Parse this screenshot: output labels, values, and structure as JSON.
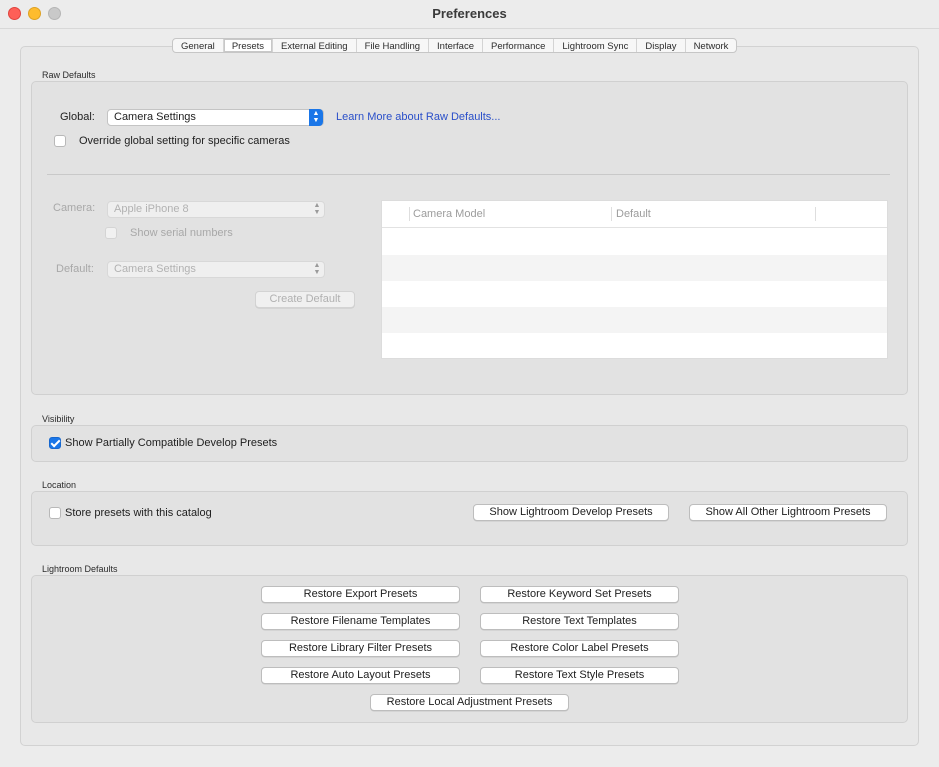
{
  "window": {
    "title": "Preferences"
  },
  "tabs": [
    {
      "label": "General",
      "active": false
    },
    {
      "label": "Presets",
      "active": true
    },
    {
      "label": "External Editing",
      "active": false
    },
    {
      "label": "File Handling",
      "active": false
    },
    {
      "label": "Interface",
      "active": false
    },
    {
      "label": "Performance",
      "active": false
    },
    {
      "label": "Lightroom Sync",
      "active": false
    },
    {
      "label": "Display",
      "active": false
    },
    {
      "label": "Network",
      "active": false
    }
  ],
  "raw_defaults": {
    "section_label": "Raw Defaults",
    "global_label": "Global:",
    "global_value": "Camera Settings",
    "learn_more": "Learn More about Raw Defaults...",
    "override_label": "Override global setting for specific cameras",
    "override_checked": false,
    "camera_label": "Camera:",
    "camera_value": "Apple iPhone 8",
    "serial_label": "Show serial numbers",
    "default_label": "Default:",
    "default_value": "Camera Settings",
    "create_default": "Create Default",
    "table": {
      "columns": [
        "Camera Model",
        "Default"
      ],
      "rows": []
    }
  },
  "visibility": {
    "section_label": "Visibility",
    "show_partial_label": "Show Partially Compatible Develop Presets",
    "show_partial_checked": true
  },
  "location": {
    "section_label": "Location",
    "store_label": "Store presets with this catalog",
    "store_checked": false,
    "show_develop": "Show Lightroom Develop Presets",
    "show_other": "Show All Other Lightroom Presets"
  },
  "lightroom_defaults": {
    "section_label": "Lightroom Defaults",
    "buttons": {
      "export": "Restore Export Presets",
      "keyword_set": "Restore Keyword Set Presets",
      "filename": "Restore Filename Templates",
      "text_templates": "Restore Text Templates",
      "library_filter": "Restore Library Filter Presets",
      "color_label": "Restore Color Label Presets",
      "auto_layout": "Restore Auto Layout Presets",
      "text_style": "Restore Text Style Presets",
      "local_adjustment": "Restore Local Adjustment Presets"
    }
  }
}
